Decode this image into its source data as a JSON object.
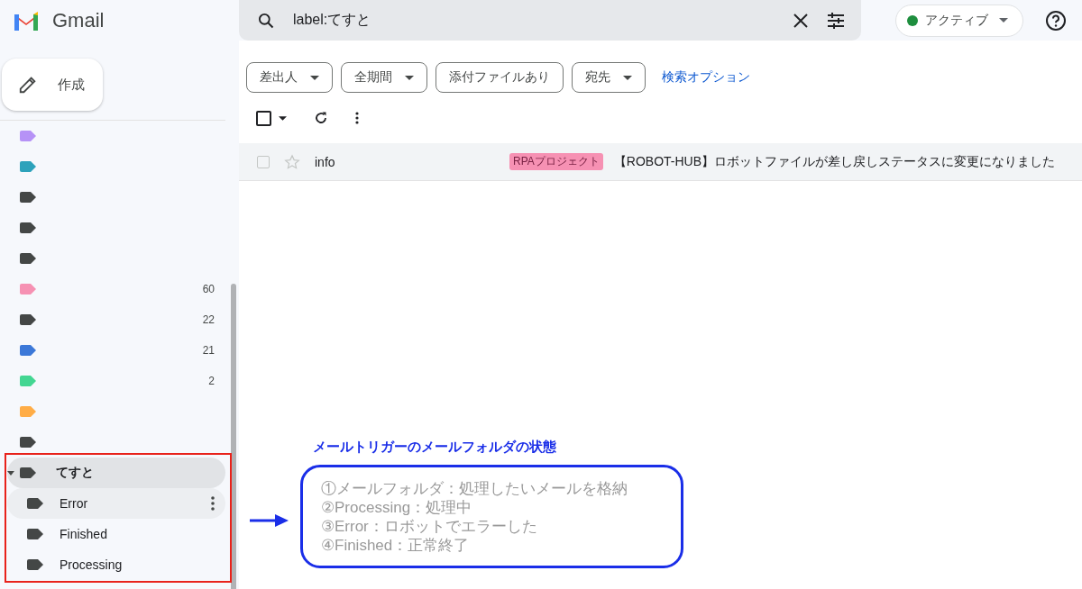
{
  "app": {
    "name": "Gmail"
  },
  "search": {
    "value": "label:てすと"
  },
  "status": {
    "label": "アクティブ",
    "color": "#1e8e3e"
  },
  "compose": {
    "label": "作成"
  },
  "labels": [
    {
      "color": "#b692f6"
    },
    {
      "color": "#2da2bb"
    },
    {
      "color": "#444746"
    },
    {
      "color": "#444746"
    },
    {
      "color": "#444746"
    },
    {
      "color": "#f691b3",
      "count": "60"
    },
    {
      "color": "#444746",
      "count": "22"
    },
    {
      "color": "#3c78d8",
      "count": "21"
    },
    {
      "color": "#43d692",
      "count": "2"
    },
    {
      "color": "#ffad47"
    },
    {
      "color": "#444746"
    },
    {
      "name": "てすと",
      "color": "#444746",
      "expanded": true,
      "selected": true,
      "children": [
        {
          "name": "Error",
          "color": "#444746",
          "hovered": true
        },
        {
          "name": "Finished",
          "color": "#444746",
          "hovered": false
        },
        {
          "name": "Processing",
          "color": "#444746",
          "hovered": false
        }
      ]
    }
  ],
  "filters": [
    {
      "label": "差出人",
      "dropdown": true
    },
    {
      "label": "全期間",
      "dropdown": true
    },
    {
      "label": "添付ファイルあり",
      "dropdown": false
    },
    {
      "label": "宛先",
      "dropdown": true
    }
  ],
  "search_options_link": "検索オプション",
  "toolbar": {
    "select_all_checked": false
  },
  "emails": [
    {
      "sender": "info",
      "read": true,
      "selected": false,
      "starred": false,
      "tag": {
        "label": "RPAプロジェクト",
        "color": "#f691b3"
      },
      "subject": "【ROBOT-HUB】ロボットファイルが差し戻しステータスに変更になりました"
    }
  ],
  "annotation": {
    "title": "メールトリガーのメールフォルダの状態",
    "lines": [
      "①メールフォルダ：処理したいメールを格納",
      "②Processing：処理中",
      "③Error：ロボットでエラーした",
      "④Finished：正常終了"
    ]
  }
}
